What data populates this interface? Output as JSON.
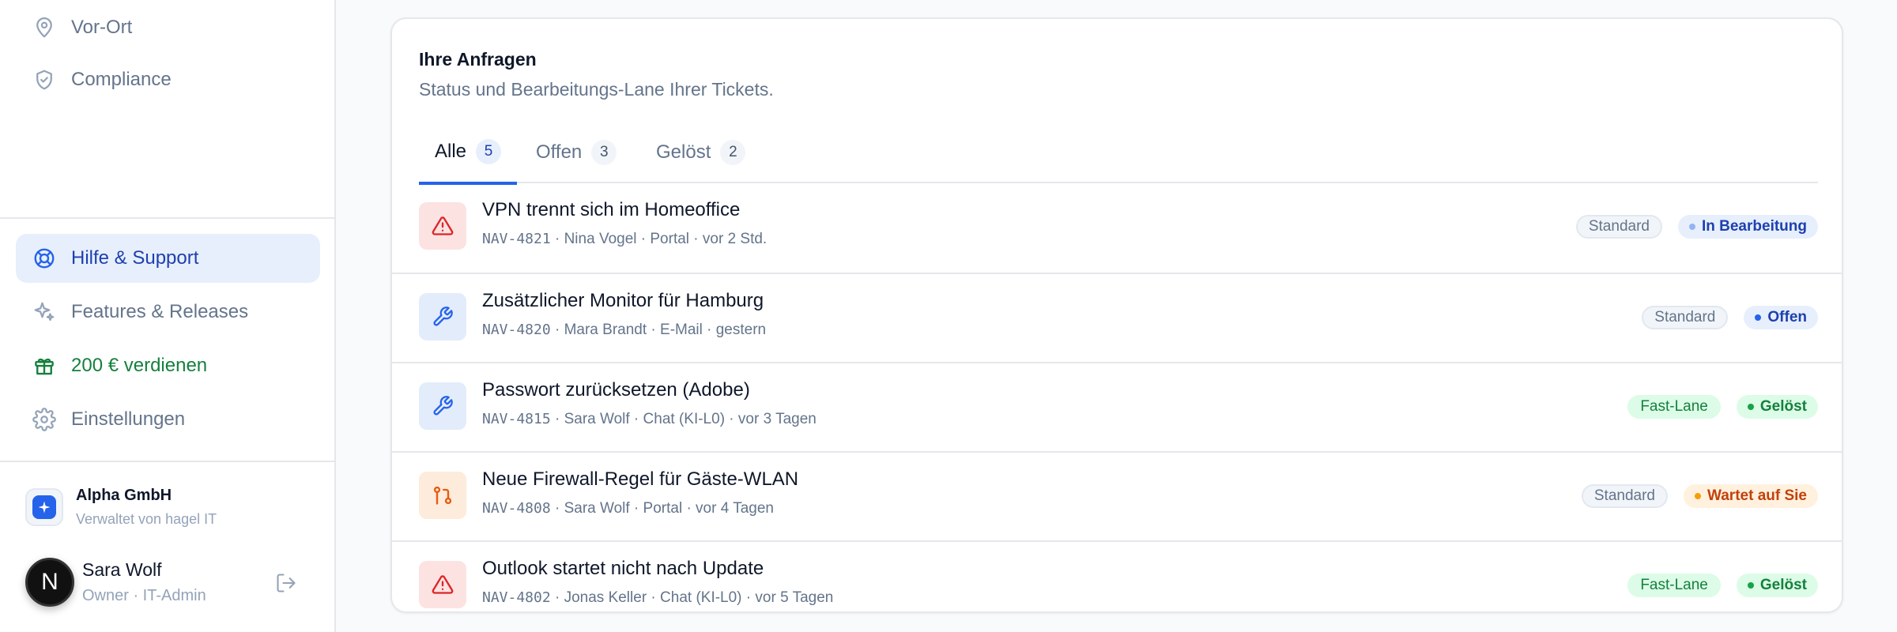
{
  "sidebar": {
    "top_items": [
      {
        "label": "Vor-Ort",
        "icon": "map-pin-icon"
      },
      {
        "label": "Compliance",
        "icon": "shield-check-icon"
      }
    ],
    "bottom_items": [
      {
        "label": "Hilfe & Support",
        "icon": "life-buoy-icon",
        "active": true
      },
      {
        "label": "Features & Releases",
        "icon": "sparkles-icon"
      },
      {
        "label": "200 € verdienen",
        "icon": "gift-icon",
        "accent": "#15803d"
      },
      {
        "label": "Einstellungen",
        "icon": "gear-icon"
      }
    ],
    "org": {
      "name": "Alpha GmbH",
      "subtitle": "Verwaltet von hagel IT"
    },
    "user": {
      "initial": "N",
      "name": "Sara Wolf",
      "role": "Owner · IT-Admin"
    }
  },
  "main": {
    "title": "Ihre Anfragen",
    "subtitle": "Status und Bearbeitungs-Lane Ihrer Tickets.",
    "tabs": [
      {
        "label": "Alle",
        "count": "5",
        "active": true
      },
      {
        "label": "Offen",
        "count": "3"
      },
      {
        "label": "Gelöst",
        "count": "2"
      }
    ],
    "tickets": [
      {
        "title": "VPN trennt sich im Homeoffice",
        "id": "NAV-4821",
        "meta": " · Nina Vogel · Portal · vor 2 Std.",
        "icon": "alert-triangle-icon",
        "lane": "Standard",
        "status": "In Bearbeitung"
      },
      {
        "title": "Zusätzlicher Monitor für Hamburg",
        "id": "NAV-4820",
        "meta": " · Mara Brandt · E-Mail · gestern",
        "icon": "wrench-icon",
        "lane": "Standard",
        "status": "Offen"
      },
      {
        "title": "Passwort zurücksetzen (Adobe)",
        "id": "NAV-4815",
        "meta": " · Sara Wolf · Chat (KI-L0) · vor 3 Tagen",
        "icon": "wrench-icon",
        "lane": "Fast-Lane",
        "status": "Gelöst"
      },
      {
        "title": "Neue Firewall-Regel für Gäste-WLAN",
        "id": "NAV-4808",
        "meta": " · Sara Wolf · Portal · vor 4 Tagen",
        "icon": "git-pull-request-icon",
        "lane": "Standard",
        "status": "Wartet auf Sie"
      },
      {
        "title": "Outlook startet nicht nach Update",
        "id": "NAV-4802",
        "meta": " · Jonas Keller · Chat (KI-L0) · vor 5 Tagen",
        "icon": "alert-triangle-icon",
        "lane": "Fast-Lane",
        "status": "Gelöst"
      }
    ]
  },
  "colors": {
    "accent": "#2563eb",
    "success": "#15803d",
    "warning": "#c2410c",
    "danger": "#dc2626"
  }
}
